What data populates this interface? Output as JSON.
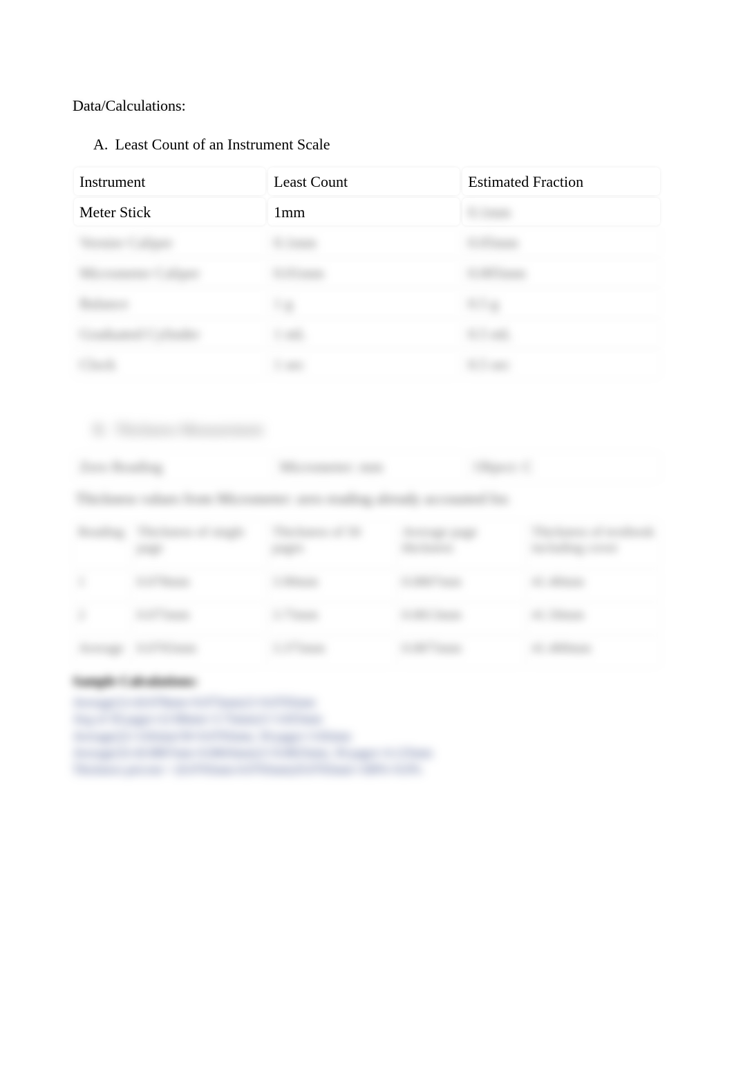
{
  "sectionTitle": "Data/Calculations:",
  "A": {
    "heading_letter": "A.",
    "heading_text": "Least Count of an Instrument Scale",
    "columns": [
      "Instrument",
      "Least Count",
      "Estimated Fraction"
    ],
    "rows": [
      {
        "instrument": "Meter Stick",
        "least": "1mm",
        "est": "0.1mm"
      },
      {
        "instrument": "Vernier Caliper",
        "least": "0.1mm",
        "est": "0.05mm"
      },
      {
        "instrument": "Micrometer Caliper",
        "least": "0.01mm",
        "est": "0.005mm"
      },
      {
        "instrument": "Balance",
        "least": "1 g",
        "est": "0.5 g"
      },
      {
        "instrument": "Graduated Cylinder",
        "least": "1 mL",
        "est": "0.5 mL"
      },
      {
        "instrument": "Clock",
        "least": "1 sec",
        "est": "0.5 sec"
      }
    ]
  },
  "B": {
    "heading_letter": "B.",
    "heading_text": "Thickness Measurement",
    "row1": {
      "zero_label": "Zero Reading",
      "instr": "Micrometer: mm",
      "obj": "Object: C"
    },
    "caption": "Thickness values from Micrometer: zero reading already accounted for.",
    "columns2": [
      "Reading",
      "Thickness of single page",
      "Thickness of 50 pages",
      "Average page thickness",
      "Thickness of textbook including cover"
    ],
    "rows2": [
      {
        "r": "1",
        "a": "0.078mm",
        "b": "3.90mm",
        "c": "0.0807mm",
        "d": "41.40mm"
      },
      {
        "r": "2",
        "a": "0.075mm",
        "b": "3.75mm",
        "c": "0.0813mm",
        "d": "41.50mm"
      },
      {
        "r": "Average",
        "a": "0.0765mm",
        "b": "3.375mm",
        "c": "0.0875mm",
        "d": "41.400mm"
      }
    ],
    "calc_title": "Sample Calculations:",
    "calc_lines": [
      "Average(1)=(0.078mm+0.075mm)/2=0.0765mm",
      "Avg of 50 pages=(3.90mm+3.75mm)/2=3.825mm",
      "Average(2)=3.82mm/50=0.0765mm, 50 pages=3.82mm",
      "Average(3)=(0.0807mm+0.0843mm)/2=0.0825mm, 50 pages=4.125mm",
      "Thickness percent = (0.0765mm-0.0765mm)/0.0765mm×100%=0.0%"
    ]
  }
}
